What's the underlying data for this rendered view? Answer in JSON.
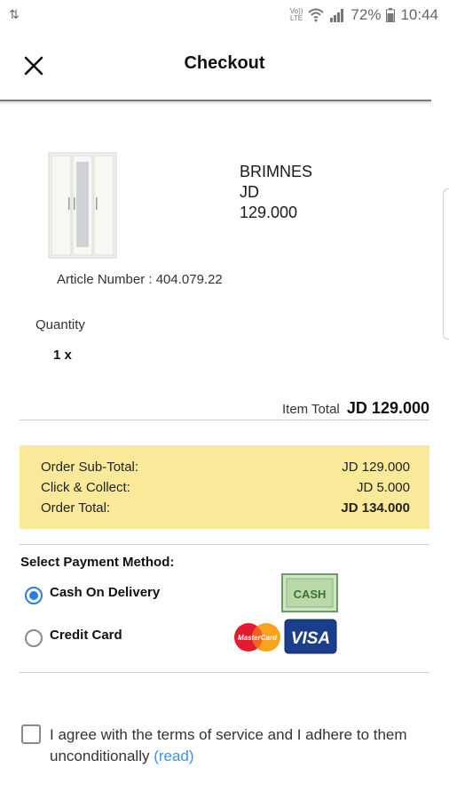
{
  "statusbar": {
    "left_icon": "data-transfer-arrows-icon",
    "carrier_line1": "Vo))",
    "carrier_line2": "LTE",
    "battery_percent": "72%",
    "time": "10:44",
    "icons": [
      "wifi-icon",
      "signal-icon",
      "battery-icon"
    ]
  },
  "appbar": {
    "title": "Checkout",
    "close_icon": "close-icon"
  },
  "product": {
    "image_icon": "wardrobe-image",
    "name": "BRIMNES",
    "currency": "JD",
    "price": "129.000",
    "article": "Article Number : 404.079.22",
    "quantity_label": "Quantity",
    "quantity_value": "1 x"
  },
  "item_total": {
    "label": "Item Total",
    "value": "JD 129.000"
  },
  "summary": {
    "background_color": "#fbe99a",
    "rows": [
      {
        "label": "Order Sub-Total:",
        "value": "JD 129.000"
      },
      {
        "label": "Click & Collect:",
        "value": "JD 5.000"
      },
      {
        "label": "Order Total:",
        "value": "JD 134.000"
      }
    ]
  },
  "payment": {
    "title": "Select Payment Method:",
    "accent_color": "#2a7de1",
    "options": [
      {
        "label": "Cash On Delivery",
        "selected": true,
        "icon": "cash-icon"
      },
      {
        "label": "Credit Card",
        "selected": false,
        "icons": [
          "mastercard-icon",
          "visa-icon"
        ]
      }
    ],
    "cash_icon_text": "CASH",
    "mastercard_text": "MasterCard",
    "visa_text": "VISA"
  },
  "terms": {
    "checked": false,
    "text": "I agree with the terms of service and I adhere to them unconditionally ",
    "link": "(read)",
    "link_color": "#3d8fe6"
  }
}
